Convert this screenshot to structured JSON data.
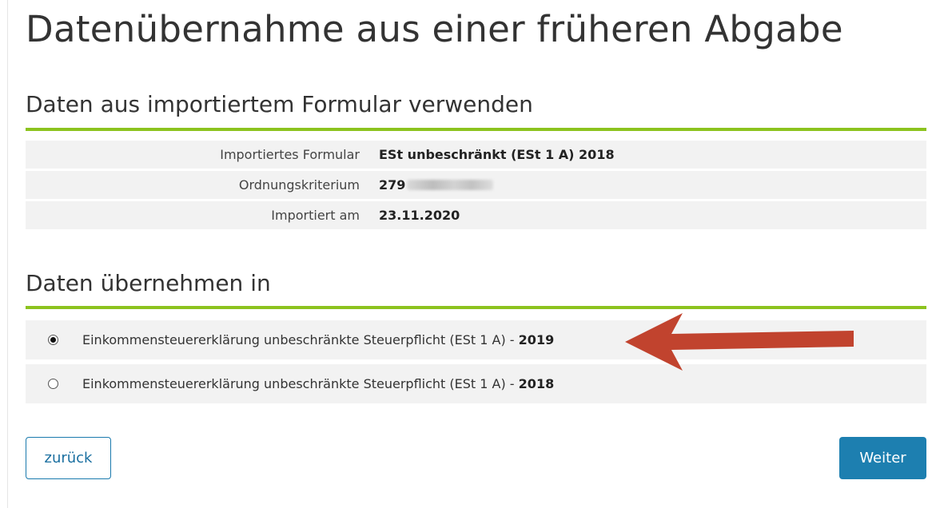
{
  "page": {
    "title": "Datenübernahme aus einer früheren Abgabe"
  },
  "colors": {
    "accent_green": "#8cc31e",
    "button_blue": "#1d7fb0",
    "arrow_red": "#c1432e"
  },
  "import_section": {
    "title": "Daten aus importiertem Formular verwenden",
    "rows": [
      {
        "label": "Importiertes Formular",
        "value": "ESt unbeschränkt (ESt 1 A) 2018"
      },
      {
        "label": "Ordnungskriterium",
        "value": "279",
        "value_redacted": true
      },
      {
        "label": "Importiert am",
        "value": "23.11.2020"
      }
    ]
  },
  "target_section": {
    "title": "Daten übernehmen in",
    "options": [
      {
        "label": "Einkommensteuererklärung unbeschränkte Steuerpflicht (ESt 1 A) - ",
        "year": "2019",
        "selected": true
      },
      {
        "label": "Einkommensteuererklärung unbeschränkte Steuerpflicht (ESt 1 A) - ",
        "year": "2018",
        "selected": false
      }
    ],
    "annotation": "red-arrow-icon"
  },
  "buttons": {
    "back": "zurück",
    "next": "Weiter"
  }
}
